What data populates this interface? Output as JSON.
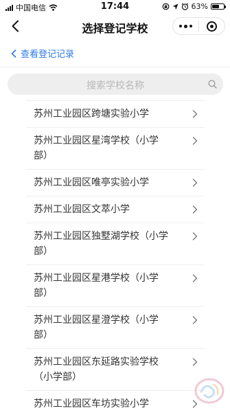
{
  "status_bar": {
    "carrier": "中国电信",
    "time": "17:44",
    "battery": "63%",
    "battery_level": 0.63
  },
  "nav": {
    "title": "选择登记学校",
    "back_icon": "chevron-left-icon",
    "more_icon": "more-dots-icon",
    "close_icon": "target-circle-icon"
  },
  "records_link": {
    "label": "查看登记记录",
    "color": "#2d7be5"
  },
  "search": {
    "placeholder": "搜索学校名称"
  },
  "schools": [
    {
      "line1": "苏州工业园区跨塘实验小学",
      "line2": ""
    },
    {
      "line1": "苏州工业园区星湾学校（小学",
      "line2": "部）"
    },
    {
      "line1": "苏州工业园区唯亭实验小学",
      "line2": ""
    },
    {
      "line1": "苏州工业园区文萃小学",
      "line2": ""
    },
    {
      "line1": "苏州工业园区独墅湖学校（小学",
      "line2": "部）"
    },
    {
      "line1": "苏州工业园区星港学校（小学",
      "line2": "部）"
    },
    {
      "line1": "苏州工业园区星澄学校（小学",
      "line2": "部）"
    },
    {
      "line1": "苏州工业园区东延路实验学校",
      "line2": "（小学部）"
    },
    {
      "line1": "苏州工业园区车坊实验小学",
      "line2": ""
    }
  ]
}
